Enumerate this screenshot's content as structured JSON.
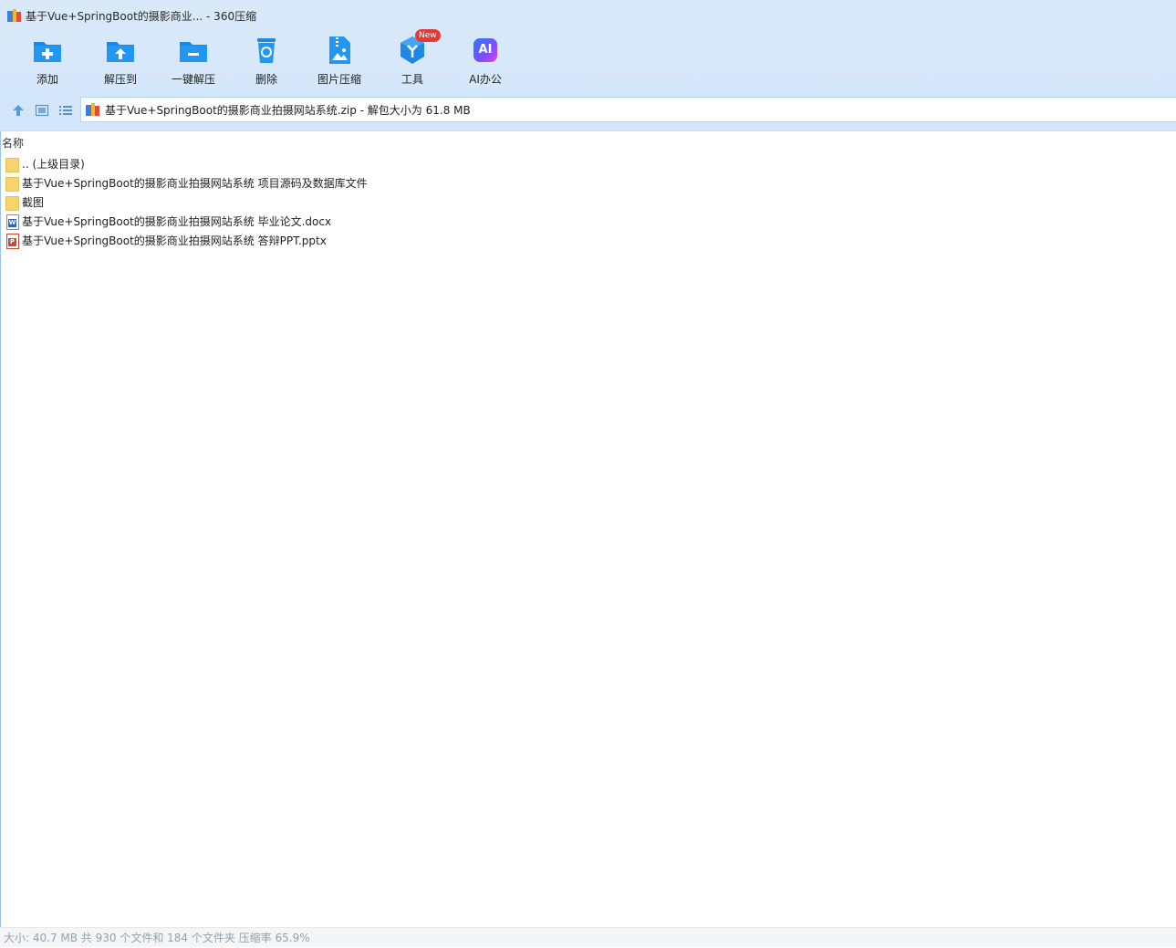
{
  "window": {
    "title": "基于Vue+SpringBoot的摄影商业... - 360压缩"
  },
  "toolbar": {
    "buttons": [
      {
        "label": "添加",
        "icon": "add-icon"
      },
      {
        "label": "解压到",
        "icon": "extract-to-icon"
      },
      {
        "label": "一键解压",
        "icon": "one-click-extract-icon"
      },
      {
        "label": "删除",
        "icon": "delete-icon"
      },
      {
        "label": "图片压缩",
        "icon": "image-compress-icon"
      },
      {
        "label": "工具",
        "icon": "tools-icon",
        "badge": "New"
      },
      {
        "label": "AI办公",
        "icon": "ai-office-icon",
        "icon_text": "AI"
      }
    ]
  },
  "path": {
    "text": "基于Vue+SpringBoot的摄影商业拍摄网站系统.zip - 解包大小为 61.8 MB"
  },
  "list": {
    "column_name": "名称",
    "items": [
      {
        "name": ".. (上级目录)",
        "type": "folder"
      },
      {
        "name": "基于Vue+SpringBoot的摄影商业拍摄网站系统 项目源码及数据库文件",
        "type": "folder"
      },
      {
        "name": "截图",
        "type": "folder"
      },
      {
        "name": "基于Vue+SpringBoot的摄影商业拍摄网站系统 毕业论文.docx",
        "type": "docx",
        "icon_letter": "W"
      },
      {
        "name": "基于Vue+SpringBoot的摄影商业拍摄网站系统 答辩PPT.pptx",
        "type": "pptx",
        "icon_letter": "P"
      }
    ]
  },
  "status": {
    "text": "大小: 40.7 MB 共 930 个文件和 184 个文件夹 压缩率 65.9%"
  },
  "colors": {
    "accent": "#1e88e5",
    "toolbar_bg": "#d6e8fa",
    "folder": "#f7d36f",
    "badge": "#e53935",
    "ai_gradient_start": "#2979ff",
    "ai_gradient_end": "#e040fb"
  }
}
